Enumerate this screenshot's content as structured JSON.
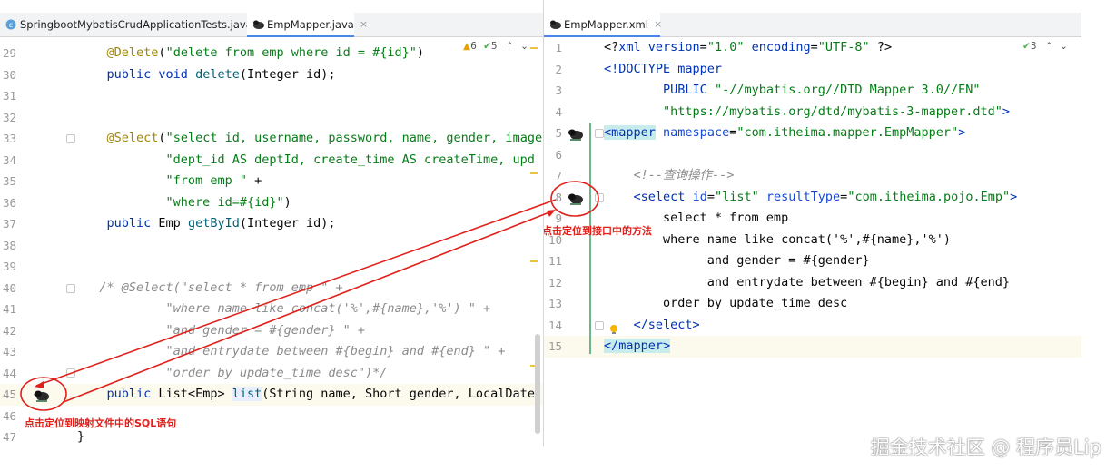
{
  "left": {
    "tabs": [
      {
        "label": "SpringbootMybatisCrudApplicationTests.java",
        "close": "×"
      },
      {
        "label": "EmpMapper.java",
        "close": "×"
      }
    ],
    "inspection": {
      "warnings": "6",
      "checks": "5"
    },
    "lines": [
      {
        "n": "29",
        "html": "    <span class=\"an\">@Delete</span>(<span class=\"st\">\"delete from emp where id = #{id}\"</span>)"
      },
      {
        "n": "30",
        "html": "    <span class=\"kw\">public void</span> <span class=\"fn\">delete</span>(Integer id);"
      },
      {
        "n": "31",
        "html": ""
      },
      {
        "n": "32",
        "html": ""
      },
      {
        "n": "33",
        "html": "    <span class=\"an\">@Select</span>(<span class=\"st\">\"select id, username, password, name, gender, image</span>"
      },
      {
        "n": "34",
        "html": "            <span class=\"st\">\"dept_id AS deptId, create_time AS createTime, upd</span>"
      },
      {
        "n": "35",
        "html": "            <span class=\"st\">\"from emp \"</span> +"
      },
      {
        "n": "36",
        "html": "            <span class=\"st\">\"where id=#{id}\"</span>)"
      },
      {
        "n": "37",
        "html": "    <span class=\"kw\">public</span> Emp <span class=\"fn\">getById</span>(Integer id);"
      },
      {
        "n": "38",
        "html": ""
      },
      {
        "n": "39",
        "html": ""
      },
      {
        "n": "40",
        "html": "   <span class=\"cm\">/* @Select(\"select * from emp \" +</span>"
      },
      {
        "n": "41",
        "html": "            <span class=\"cm\">\"where name like concat('%',#{name},'%') \" +</span>"
      },
      {
        "n": "42",
        "html": "            <span class=\"cm\">\"and gender = #{gender} \" +</span>"
      },
      {
        "n": "43",
        "html": "            <span class=\"cm\">\"and entrydate between #{begin} and #{end} \" +</span>"
      },
      {
        "n": "44",
        "html": "            <span class=\"cm\">\"order by update_time desc\")*/</span>"
      },
      {
        "n": "45",
        "html": "    <span class=\"kw\">public</span> List&lt;Emp&gt; <span class=\"fn\" style=\"background:#e8eefc\">list</span>(String name, Short gender, LocalDate"
      },
      {
        "n": "46",
        "html": ""
      },
      {
        "n": "47",
        "html": "}"
      }
    ],
    "annotation": "点击定位到映射文件中的SQL语句"
  },
  "right": {
    "tabs": [
      {
        "label": "EmpMapper.xml",
        "close": "×"
      }
    ],
    "inspection": {
      "checks": "3"
    },
    "lines": [
      {
        "n": "1",
        "html": "<span class=\"plain\">&lt;?</span><span class=\"tg\">xml version</span>=<span class=\"av\">\"1.0\"</span> <span class=\"tg\">encoding</span>=<span class=\"av\">\"UTF-8\"</span> <span class=\"plain\">?&gt;</span>"
      },
      {
        "n": "2",
        "html": "<span class=\"tg\">&lt;!DOCTYPE mapper</span>"
      },
      {
        "n": "3",
        "html": "        <span class=\"tg\">PUBLIC</span> <span class=\"av\">\"-//mybatis.org//DTD Mapper 3.0//EN\"</span>"
      },
      {
        "n": "4",
        "html": "        <span class=\"av\">\"https://mybatis.org/dtd/mybatis-3-mapper.dtd\"</span><span class=\"tg\">&gt;</span>"
      },
      {
        "n": "5",
        "html": "<span style=\"background:#c8ecec\"><span class=\"tg\">&lt;mapper</span></span> <span class=\"at\">namespace</span>=<span class=\"av\">\"com.itheima.mapper.EmpMapper\"</span><span class=\"tg\">&gt;</span>"
      },
      {
        "n": "6",
        "html": ""
      },
      {
        "n": "7",
        "html": "    <span class=\"cm\">&lt;!--查询操作--&gt;</span>"
      },
      {
        "n": "8",
        "html": "    <span class=\"tg\">&lt;select</span> <span class=\"at\">id</span>=<span class=\"av\">\"list\"</span> <span class=\"at\">resultType</span>=<span class=\"av\">\"com.itheima.pojo.Emp\"</span><span class=\"tg\">&gt;</span>"
      },
      {
        "n": "9",
        "html": "        select * from emp"
      },
      {
        "n": "10",
        "html": "        where name like concat('%',#{name},'%')"
      },
      {
        "n": "11",
        "html": "              and gender = #{gender}"
      },
      {
        "n": "12",
        "html": "              and entrydate between #{begin} and #{end}"
      },
      {
        "n": "13",
        "html": "        order by update_time desc"
      },
      {
        "n": "14",
        "html": "    <span class=\"tg\">&lt;/select&gt;</span>"
      },
      {
        "n": "15",
        "html": "<span style=\"background:#c8ecec\"><span class=\"tg\">&lt;/mapper&gt;</span></span>"
      }
    ],
    "annotation": "点击定位到接口中的方法"
  },
  "watermark": "掘金技术社区 @ 程序员Lip",
  "colors": {
    "annotation": "#e0201a",
    "current_line": "#fcfaed",
    "tab_underline": "#4a86e8"
  }
}
